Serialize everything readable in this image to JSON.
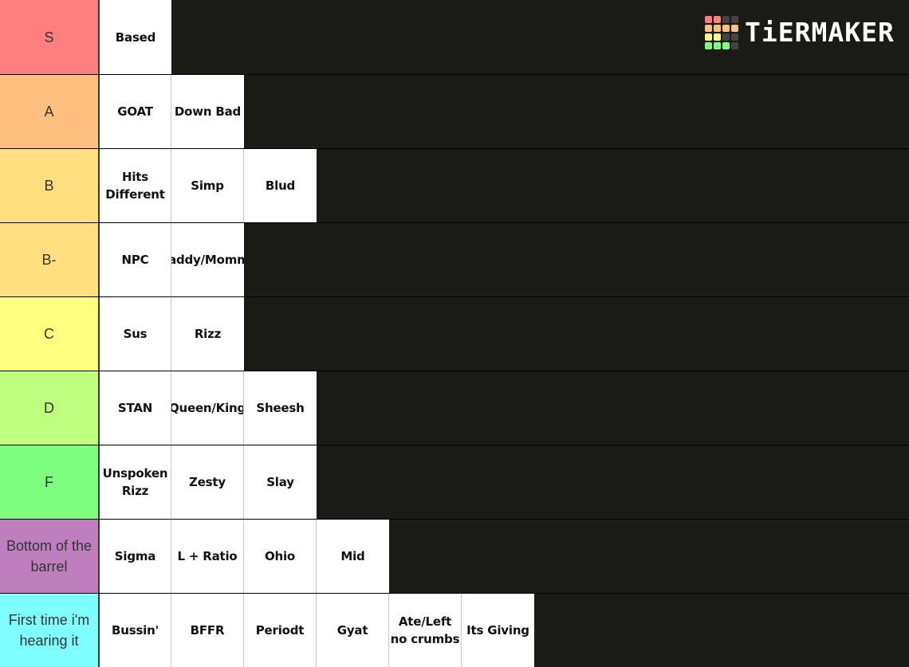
{
  "logo": {
    "text": "TiERMAKER",
    "grid_colors": [
      "#ff7f7f",
      "#ff7f7f",
      "#444444",
      "#444444",
      "#ffbf7f",
      "#ffbf7f",
      "#ffbf7f",
      "#ffbf7f",
      "#ffff7f",
      "#ffff7f",
      "#444444",
      "#444444",
      "#7fff7f",
      "#7fff7f",
      "#7fff7f",
      "#444444"
    ]
  },
  "tiers": [
    {
      "label": "S",
      "color": "#ff7f7f",
      "items": [
        "Based"
      ]
    },
    {
      "label": "A",
      "color": "#ffbf7f",
      "items": [
        "GOAT",
        "Down Bad"
      ]
    },
    {
      "label": "B",
      "color": "#ffdf7f",
      "items": [
        "Hits Different",
        "Simp",
        "Blud"
      ]
    },
    {
      "label": "B-",
      "color": "#ffdf7f",
      "items": [
        "NPC",
        "Daddy/Mommy"
      ]
    },
    {
      "label": "C",
      "color": "#ffff7f",
      "items": [
        "Sus",
        "Rizz"
      ]
    },
    {
      "label": "D",
      "color": "#bfff7f",
      "items": [
        "STAN",
        "Queen/King",
        "Sheesh"
      ]
    },
    {
      "label": "F",
      "color": "#7fff7f",
      "items": [
        "Unspoken Rizz",
        "Zesty",
        "Slay"
      ]
    },
    {
      "label": "Bottom of the barrel",
      "color": "#bf7fbf",
      "items": [
        "Sigma",
        "L + Ratio",
        "Ohio",
        "Mid"
      ]
    },
    {
      "label": "First time i'm hearing it",
      "color": "#7fffff",
      "items": [
        "Bussin'",
        "BFFR",
        "Periodt",
        "Gyat",
        "Ate/Left no crumbs",
        "Its Giving"
      ]
    }
  ]
}
